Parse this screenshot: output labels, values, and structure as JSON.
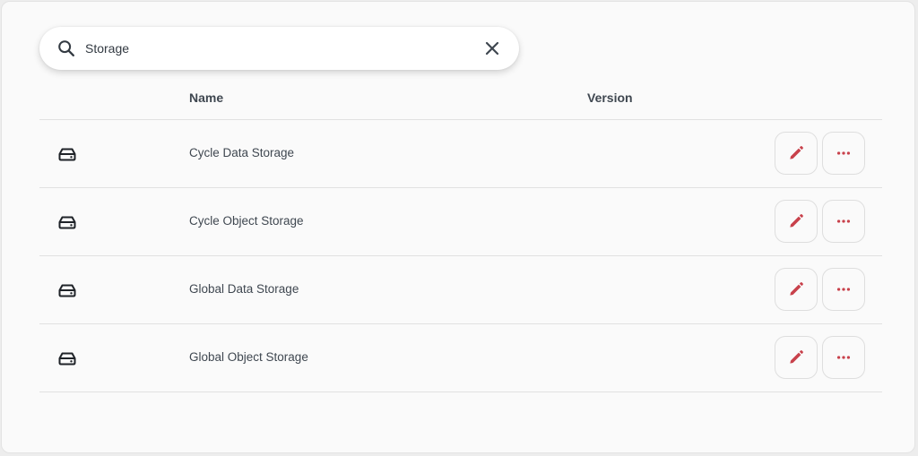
{
  "search": {
    "value": "Storage",
    "icon": "search-icon",
    "clear_icon": "close-icon"
  },
  "table": {
    "columns": {
      "name": "Name",
      "version": "Version"
    },
    "rows": [
      {
        "icon": "storage-drive-icon",
        "name": "Cycle Data Storage",
        "version": ""
      },
      {
        "icon": "storage-drive-icon",
        "name": "Cycle Object Storage",
        "version": ""
      },
      {
        "icon": "storage-drive-icon",
        "name": "Global Data Storage",
        "version": ""
      },
      {
        "icon": "storage-drive-icon",
        "name": "Global Object Storage",
        "version": ""
      }
    ],
    "row_actions": {
      "edit_icon": "pencil-icon",
      "more_icon": "more-horizontal-icon"
    }
  },
  "colors": {
    "accent": "#c8414b",
    "text": "#3f4750",
    "icon": "#1f2328",
    "divider": "#e1e1e1"
  }
}
